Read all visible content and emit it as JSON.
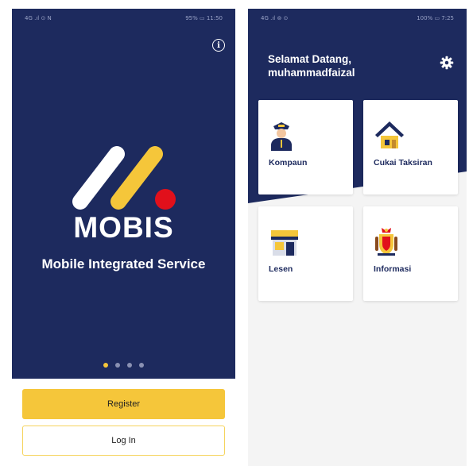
{
  "left_screen": {
    "status_left": "4G .ıl ⊙ N",
    "status_right": "95% ▭ 11:50",
    "brand": "MOBIS",
    "tagline": "Mobile Integrated Service",
    "carousel_total": 4,
    "carousel_active": 1,
    "register_label": "Register",
    "login_label": "Log In"
  },
  "right_screen": {
    "status_left": "4G .ıl ⊚ ⊙",
    "status_right": "100% ▭ 7:25",
    "welcome_line1": "Selamat Datang,",
    "welcome_line2": "muhammadfaizal",
    "tiles": [
      {
        "label": "Kompaun",
        "icon": "officer-icon"
      },
      {
        "label": "Cukai Taksiran",
        "icon": "house-icon"
      },
      {
        "label": "Lesen",
        "icon": "shop-icon"
      },
      {
        "label": "Informasi",
        "icon": "crest-icon"
      }
    ]
  },
  "colors": {
    "navy": "#1d2a5e",
    "yellow": "#f5c63a",
    "red": "#e1101b"
  }
}
